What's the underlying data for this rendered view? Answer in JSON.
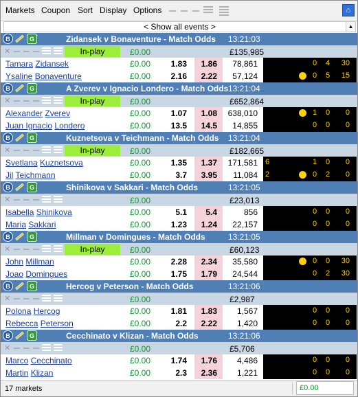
{
  "menu": {
    "items": [
      "Markets",
      "Coupon",
      "Sort",
      "Display",
      "Options"
    ]
  },
  "show_all": "< Show all events >",
  "in_play_label": "In-play",
  "events": [
    {
      "title": "Zidansek v Bonaventure - Match Odds",
      "time": "13:21:03",
      "inplay": true,
      "amount": "£0.00",
      "matched": "£135,985",
      "runners": [
        {
          "first": "Tamara",
          "last": "Zidansek",
          "pnl": "£0.00",
          "back": "1.83",
          "lay": "1.86",
          "vol": "78,861",
          "score": {
            "srv": "",
            "ball": false,
            "s1": "0",
            "s2": "4",
            "s3": "30"
          }
        },
        {
          "first": "Ysaline",
          "last": "Bonaventure",
          "pnl": "£0.00",
          "back": "2.16",
          "lay": "2.22",
          "vol": "57,124",
          "score": {
            "srv": "",
            "ball": true,
            "s1": "0",
            "s2": "5",
            "s3": "15"
          }
        }
      ]
    },
    {
      "title": "A Zverev v Ignacio Londero - Match Odds",
      "time": "13:21:04",
      "inplay": true,
      "amount": "£0.00",
      "matched": "£652,864",
      "runners": [
        {
          "first": "Alexander",
          "last": "Zverev",
          "pnl": "£0.00",
          "back": "1.07",
          "lay": "1.08",
          "vol": "638,010",
          "score": {
            "srv": "",
            "ball": true,
            "s1": "1",
            "s2": "0",
            "s3": "0"
          }
        },
        {
          "first": "Juan Ignacio",
          "last": "Londero",
          "pnl": "£0.00",
          "back": "13.5",
          "lay": "14.5",
          "vol": "14,855",
          "score": {
            "srv": "",
            "ball": false,
            "s1": "0",
            "s2": "0",
            "s3": "0"
          }
        }
      ]
    },
    {
      "title": "Kuznetsova v Teichmann - Match Odds",
      "time": "13:21:04",
      "inplay": true,
      "amount": "£0.00",
      "matched": "£182,665",
      "runners": [
        {
          "first": "Svetlana",
          "last": "Kuznetsova",
          "pnl": "£0.00",
          "back": "1.35",
          "lay": "1.37",
          "vol": "171,581",
          "score": {
            "srv": "6",
            "ball": false,
            "s1": "1",
            "s2": "0",
            "s3": "0"
          }
        },
        {
          "first": "Jil",
          "last": "Teichmann",
          "pnl": "£0.00",
          "back": "3.7",
          "lay": "3.95",
          "vol": "11,084",
          "score": {
            "srv": "2",
            "ball": true,
            "s1": "0",
            "s2": "2",
            "s3": "0"
          }
        }
      ]
    },
    {
      "title": "Shinikova v Sakkari - Match Odds",
      "time": "13:21:05",
      "inplay": false,
      "amount": "£0.00",
      "matched": "£23,013",
      "runners": [
        {
          "first": "Isabella",
          "last": "Shinikova",
          "pnl": "£0.00",
          "back": "5.1",
          "lay": "5.4",
          "vol": "856",
          "score": {
            "srv": "",
            "ball": false,
            "s1": "0",
            "s2": "0",
            "s3": "0"
          }
        },
        {
          "first": "Maria",
          "last": "Sakkari",
          "pnl": "£0.00",
          "back": "1.23",
          "lay": "1.24",
          "vol": "22,157",
          "score": {
            "srv": "",
            "ball": false,
            "s1": "0",
            "s2": "0",
            "s3": "0"
          }
        }
      ]
    },
    {
      "title": "Millman v Domingues - Match Odds",
      "time": "13:21:05",
      "inplay": true,
      "amount": "£0.00",
      "matched": "£60,123",
      "runners": [
        {
          "first": "John",
          "last": "Millman",
          "pnl": "£0.00",
          "back": "2.28",
          "lay": "2.34",
          "vol": "35,580",
          "score": {
            "srv": "",
            "ball": true,
            "s1": "0",
            "s2": "0",
            "s3": "30"
          }
        },
        {
          "first": "Joao",
          "last": "Domingues",
          "pnl": "£0.00",
          "back": "1.75",
          "lay": "1.79",
          "vol": "24,544",
          "score": {
            "srv": "",
            "ball": false,
            "s1": "0",
            "s2": "2",
            "s3": "30"
          }
        }
      ]
    },
    {
      "title": "Hercog v Peterson - Match Odds",
      "time": "13:21:06",
      "inplay": false,
      "amount": "£0.00",
      "matched": "£2,987",
      "runners": [
        {
          "first": "Polona",
          "last": "Hercog",
          "pnl": "£0.00",
          "back": "1.81",
          "lay": "1.83",
          "vol": "1,567",
          "score": {
            "srv": "",
            "ball": false,
            "s1": "0",
            "s2": "0",
            "s3": "0"
          }
        },
        {
          "first": "Rebecca",
          "last": "Peterson",
          "pnl": "£0.00",
          "back": "2.2",
          "lay": "2.22",
          "vol": "1,420",
          "score": {
            "srv": "",
            "ball": false,
            "s1": "0",
            "s2": "0",
            "s3": "0"
          }
        }
      ]
    },
    {
      "title": "Cecchinato v Klizan - Match Odds",
      "time": "13:21:06",
      "inplay": false,
      "amount": "£0.00",
      "matched": "£5,706",
      "runners": [
        {
          "first": "Marco",
          "last": "Cecchinato",
          "pnl": "£0.00",
          "back": "1.74",
          "lay": "1.76",
          "vol": "4,486",
          "score": {
            "srv": "",
            "ball": false,
            "s1": "0",
            "s2": "0",
            "s3": "0"
          }
        },
        {
          "first": "Martin",
          "last": "Klizan",
          "pnl": "£0.00",
          "back": "2.3",
          "lay": "2.36",
          "vol": "1,221",
          "score": {
            "srv": "",
            "ball": false,
            "s1": "0",
            "s2": "0",
            "s3": "0"
          }
        }
      ]
    }
  ],
  "status": {
    "markets": "17 markets",
    "balance": "£0.00"
  },
  "colors": {
    "header": "#4f7fb4",
    "inplay": "#9bef3a",
    "lay": "#f5d2dc",
    "score_bg": "#000000",
    "score_fg": "#ffd200",
    "money": "#0a9a2a"
  },
  "icons": {
    "b": "B",
    "g": "G",
    "bat": "bat-icon",
    "pin": "pin-icon"
  }
}
